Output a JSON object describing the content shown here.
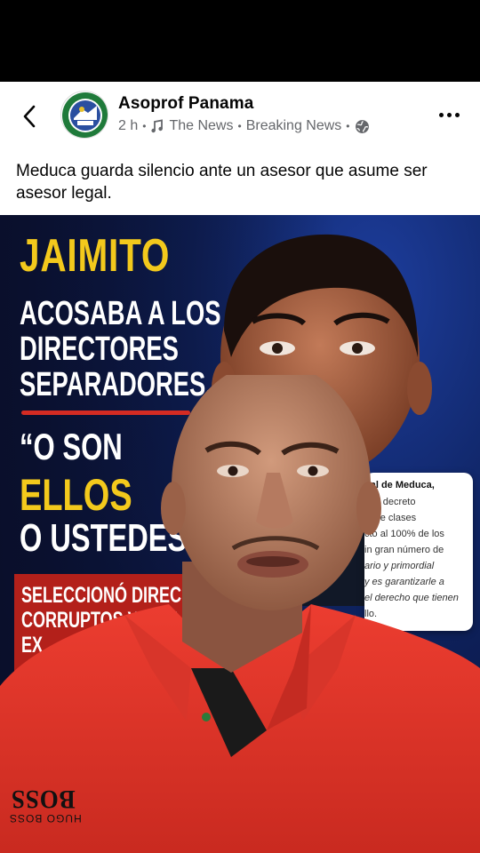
{
  "post": {
    "page_name": "Asoprof Panama",
    "time": "2 h",
    "sep": "•",
    "channel": "The News",
    "category": "Breaking News",
    "caption": "Meduca guarda silencio ante un asesor que asume ser asesor legal."
  },
  "icons": {
    "back": "chevron-left-icon",
    "music": "music-note-icon",
    "audience": "globe-icon",
    "more": "more-horizontal-icon"
  },
  "media": {
    "headline_1": "JAIMITO",
    "headline_2": "ACOSABA A LOS",
    "headline_3": "DIRECTORES",
    "headline_4": "SEPARADORES...",
    "quote_1": "“O SON",
    "quote_2": "ELLOS",
    "quote_3": "O USTEDES”",
    "box_line_1": "SELECCIONÓ DIREC",
    "box_line_2": "CORRUPTOS Y CON",
    "box_line_3": "EX",
    "doc_lines": [
      "gal de Meduca,",
      "e el decreto",
      "in de clases",
      "ctó al 100% de los",
      "in gran número de",
      "ario y primordial",
      "y es garantizarle a",
      "el derecho que tienen",
      "llo."
    ],
    "shirt_logo": "BOSS",
    "shirt_logo_sub": "HUGO BOSS"
  },
  "colors": {
    "accent_yellow": "#f3c91c",
    "accent_red": "#d42b23",
    "shirt_red": "#e3362b",
    "bg_blue": "#0f2463"
  }
}
